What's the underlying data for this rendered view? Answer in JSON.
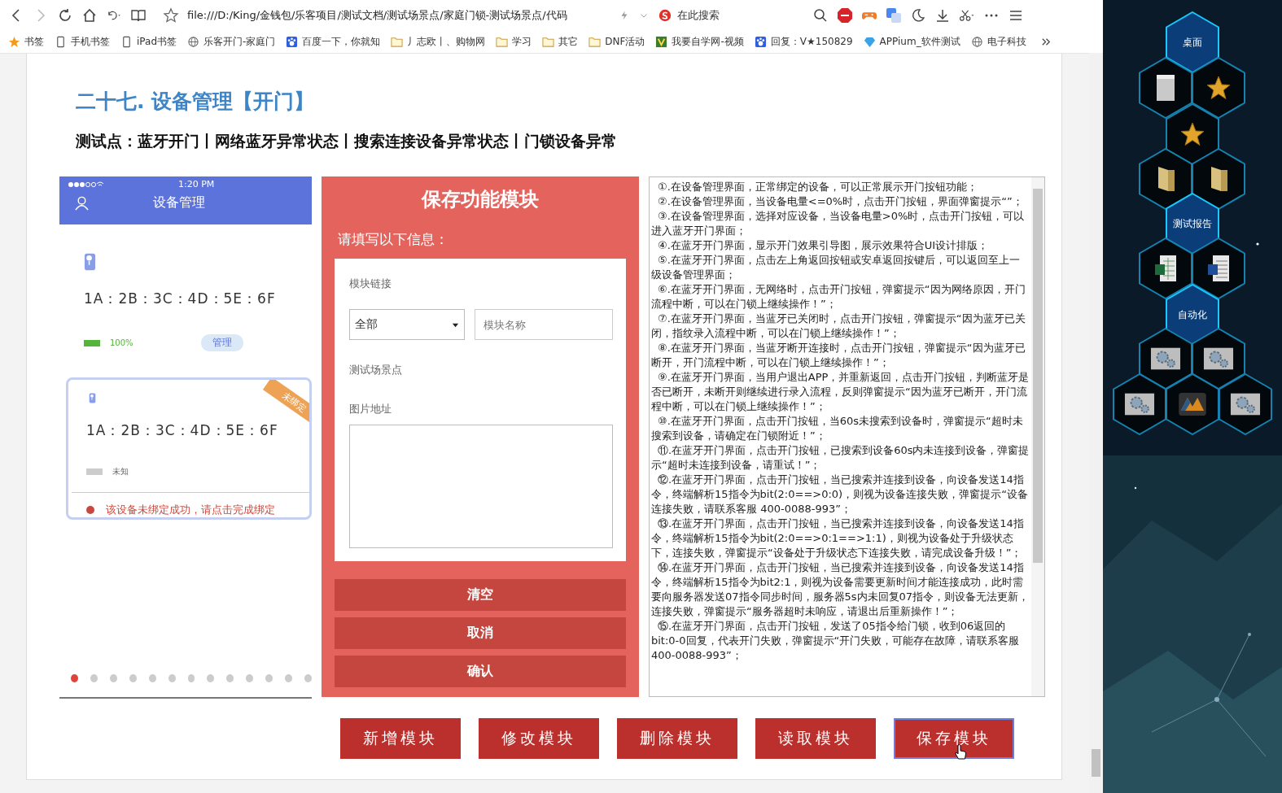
{
  "browser": {
    "url": "file:///D:/King/金钱包/乐客项目/测试文档/测试场景点/家庭门锁-测试场景点/代码",
    "search": {
      "placeholder": "在此搜索"
    },
    "bookmarks": [
      {
        "label": "书签",
        "kind": "star"
      },
      {
        "label": "手机书签",
        "kind": "device"
      },
      {
        "label": "iPad书签",
        "kind": "device"
      },
      {
        "label": "乐客开门-家庭门",
        "kind": "globe"
      },
      {
        "label": "百度一下，你就知",
        "kind": "paw"
      },
      {
        "label": "丿志欧丨、购物网",
        "kind": "folder"
      },
      {
        "label": "学习",
        "kind": "folder"
      },
      {
        "label": "其它",
        "kind": "folder"
      },
      {
        "label": "DNF活动",
        "kind": "folder"
      },
      {
        "label": "我要自学网-视频",
        "kind": "site"
      },
      {
        "label": "回复：V★150829",
        "kind": "paw"
      },
      {
        "label": "APPium_软件测试",
        "kind": "gem"
      },
      {
        "label": "电子科技",
        "kind": "globe"
      }
    ]
  },
  "page": {
    "heading": "二十七. 设备管理【开门】",
    "test_points": "测试点：蓝牙开门丨网络蓝牙异常状态丨搜索连接设备异常状态丨门锁设备异常",
    "phone": {
      "time": "1:20 PM",
      "title": "设备管理",
      "devices": [
        {
          "mac": "1A：2B：3C：4D：5E：6F",
          "battery": "100%",
          "bound": true,
          "action": "管理"
        },
        {
          "mac": "1A：2B：3C：4D：5E：6F",
          "battery": "未知",
          "bound": false,
          "ribbon": "未绑定",
          "warning": "该设备未绑定成功，请点击完成绑定"
        }
      ],
      "dots": [
        {
          "selected": true
        },
        {
          "selected": false
        },
        {
          "selected": false
        },
        {
          "selected": false
        },
        {
          "selected": false
        },
        {
          "selected": false
        },
        {
          "selected": false
        },
        {
          "selected": false
        },
        {
          "selected": false
        },
        {
          "selected": false
        },
        {
          "selected": false
        },
        {
          "selected": false
        },
        {
          "selected": false
        }
      ]
    },
    "cases": [
      "①.在设备管理界面，正常绑定的设备，可以正常展示开门按钮功能；",
      "②.在设备管理界面，当设备电量<=0%时，点击开门按钮，界面弹窗提示“”；",
      "③.在设备管理界面，选择对应设备，当设备电量>0%时，点击开门按钮，可以进入蓝牙开门界面；",
      "④.在蓝牙开门界面，显示开门效果引导图，展示效果符合UI设计排版；",
      "⑤.在蓝牙开门界面，点击左上角返回按钮或安卓返回按键后，可以返回至上一级设备管理界面；",
      "⑥.在蓝牙开门界面，无网络时，点击开门按钮，弹窗提示“因为网络原因，开门流程中断，可以在门锁上继续操作！”；",
      "⑦.在蓝牙开门界面，当蓝牙已关闭时，点击开门按钮，弹窗提示“因为蓝牙已关闭，指纹录入流程中断，可以在门锁上继续操作！”；",
      "⑧.在蓝牙开门界面，当蓝牙断开连接时，点击开门按钮，弹窗提示“因为蓝牙已断开，开门流程中断，可以在门锁上继续操作！”；",
      "⑨.在蓝牙开门界面，当用户退出APP，并重新返回，点击开门按钮，判断蓝牙是否已断开，未断开则继续进行录入流程，反则弹窗提示“因为蓝牙已断开，开门流程中断，可以在门锁上继续操作！”；",
      "⑩.在蓝牙开门界面，点击开门按钮，当60s未搜索到设备时，弹窗提示“超时未搜索到设备，请确定在门锁附近！”；",
      "⑪.在蓝牙开门界面，点击开门按钮，已搜索到设备60s内未连接到设备，弹窗提示“超时未连接到设备，请重试！”；",
      "⑫.在蓝牙开门界面，点击开门按钮，当已搜索并连接到设备，向设备发送14指令，终端解析15指令为bit(2:0==>0:0)，则视为设备连接失败，弹窗提示“设备连接失败，请联系客服 400-0088-993”；",
      "⑬.在蓝牙开门界面，点击开门按钮，当已搜索并连接到设备，向设备发送14指令，终端解析15指令为bit(2:0==>0:1==>1:1)，则视为设备处于升级状态下，连接失败，弹窗提示“设备处于升级状态下连接失败，请完成设备升级！”；",
      "⑭.在蓝牙开门界面，点击开门按钮，当已搜索并连接到设备，向设备发送14指令，终端解析15指令为bit2:1，则视为设备需要更新时间才能连接成功，此时需要向服务器发送07指令同步时间，服务器5s内未回复07指令，则设备无法更新，连接失败，弹窗提示“服务器超时未响应，请退出后重新操作！”；",
      "⑮.在蓝牙开门界面，点击开门按钮，发送了05指令给门锁，收到06返回的bit:0-0回复，代表开门失败，弹窗提示“开门失败，可能存在故障，请联系客服 400-0088-993”；"
    ],
    "actions": [
      {
        "label": "新增模块",
        "selected": false
      },
      {
        "label": "修改模块",
        "selected": false
      },
      {
        "label": "删除模块",
        "selected": false
      },
      {
        "label": "读取模块",
        "selected": false
      },
      {
        "label": "保存模块",
        "selected": true
      }
    ]
  },
  "dialog": {
    "title": "保存功能模块",
    "prompt": "请填写以下信息：",
    "fields": [
      {
        "kind": "label",
        "label": "模块链接"
      },
      {
        "kind": "select",
        "value": "全部",
        "placeholder": "模块名称"
      },
      {
        "kind": "label",
        "label": "测试场景点"
      },
      {
        "kind": "area",
        "label": "图片地址"
      }
    ],
    "buttons": [
      "清空",
      "取消",
      "确认"
    ]
  },
  "desktop": {
    "tiles": [
      {
        "kind": "label",
        "label": "桌面"
      },
      {
        "kind": "document"
      },
      {
        "kind": "star"
      },
      {
        "kind": "star"
      },
      {
        "kind": "folder"
      },
      {
        "kind": "folder"
      },
      {
        "kind": "label",
        "label": "测试报告"
      },
      {
        "kind": "sheet"
      },
      {
        "kind": "doc"
      },
      {
        "kind": "label",
        "label": "自动化"
      },
      {
        "kind": "gears"
      },
      {
        "kind": "gears"
      },
      {
        "kind": "gears"
      },
      {
        "kind": "app"
      },
      {
        "kind": "gears"
      }
    ]
  }
}
